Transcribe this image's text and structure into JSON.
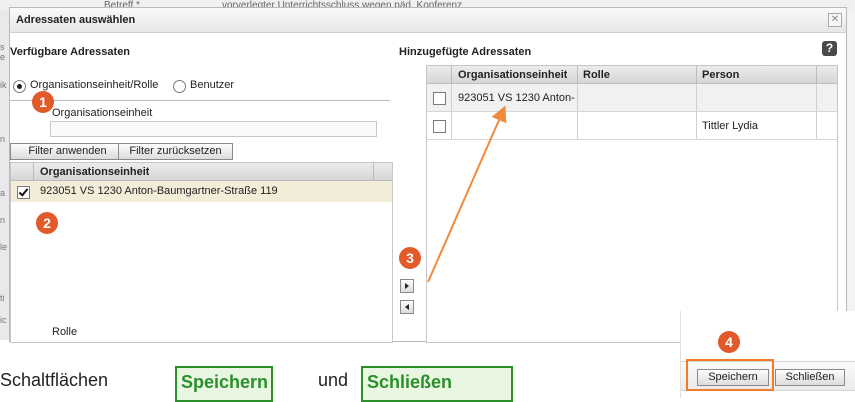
{
  "background": {
    "field_label": "Betreff *",
    "field_value": "vorverlegter Unterrichtsschluss wegen päd. Konferenz"
  },
  "dialog": {
    "title": "Adressaten auswählen",
    "close_icon": "close-icon",
    "left": {
      "heading": "Verfügbare Adressaten",
      "radio_options": [
        {
          "label": "Organisationseinheit/Rolle",
          "selected": true
        },
        {
          "label": "Benutzer",
          "selected": false
        }
      ],
      "filter_label": "Organisationseinheit",
      "filter_value": "",
      "apply_button": "Filter anwenden",
      "reset_button": "Filter zurücksetzen",
      "grid_header": "Organisationseinheit",
      "rows": [
        {
          "checked": true,
          "name": "923051 VS 1230 Anton-Baumgartner-Straße 119"
        }
      ],
      "bottom_label": "Rolle"
    },
    "right": {
      "heading": "Hinzugefügte Adressaten",
      "help_icon": "question-icon",
      "columns": [
        "Organisationseinheit",
        "Rolle",
        "Person"
      ],
      "rows": [
        {
          "org": "923051 VS 1230 Anton-",
          "rolle": "",
          "person": ""
        },
        {
          "org": "",
          "rolle": "",
          "person": "Tittler Lydia"
        }
      ]
    },
    "move_right_icon": "triangle-right-icon",
    "move_left_icon": "triangle-left-icon"
  },
  "markers": [
    "1",
    "2",
    "3",
    "4"
  ],
  "footer": {
    "save_button": "Speichern",
    "close_button": "Schließen"
  },
  "caption": {
    "prefix": "Schaltflächen",
    "highlight1": "Speichern",
    "middle": "und",
    "highlight2": "Schließen"
  },
  "colors": {
    "marker": "#e25a2a",
    "highlight_border": "#f07b2a",
    "caption_highlight": "#2b8f2b"
  }
}
